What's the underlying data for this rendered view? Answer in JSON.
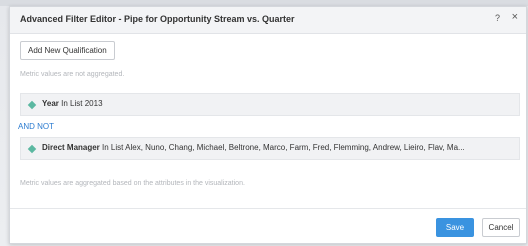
{
  "dialog": {
    "title": "Advanced Filter Editor - Pipe for Opportunity Stream vs. Quarter",
    "help_icon": "?",
    "close_icon": "×"
  },
  "toolbar": {
    "add_label": "Add New Qualification"
  },
  "notes": {
    "top": "Metric values are not aggregated.",
    "bottom": "Metric values are aggregated based on the attributes in the visualization."
  },
  "qualifications": [
    {
      "icon": "attribute-diamond-icon",
      "attribute": "Year",
      "operator": "In List",
      "values": "2013"
    },
    {
      "icon": "attribute-diamond-icon",
      "attribute": "Direct Manager",
      "operator": "In List",
      "values": "Alex, Nuno,  Chang, Michael,  Beltrone, Marco,  Farm, Fred,  Flemming, Andrew,  Lieiro, Flav,  Ma..."
    }
  ],
  "operator_between": "AND NOT",
  "footer": {
    "save_label": "Save",
    "cancel_label": "Cancel"
  },
  "colors": {
    "accent": "#3a93e0",
    "diamond": "#5bb8a1",
    "link": "#2b7bd0"
  }
}
